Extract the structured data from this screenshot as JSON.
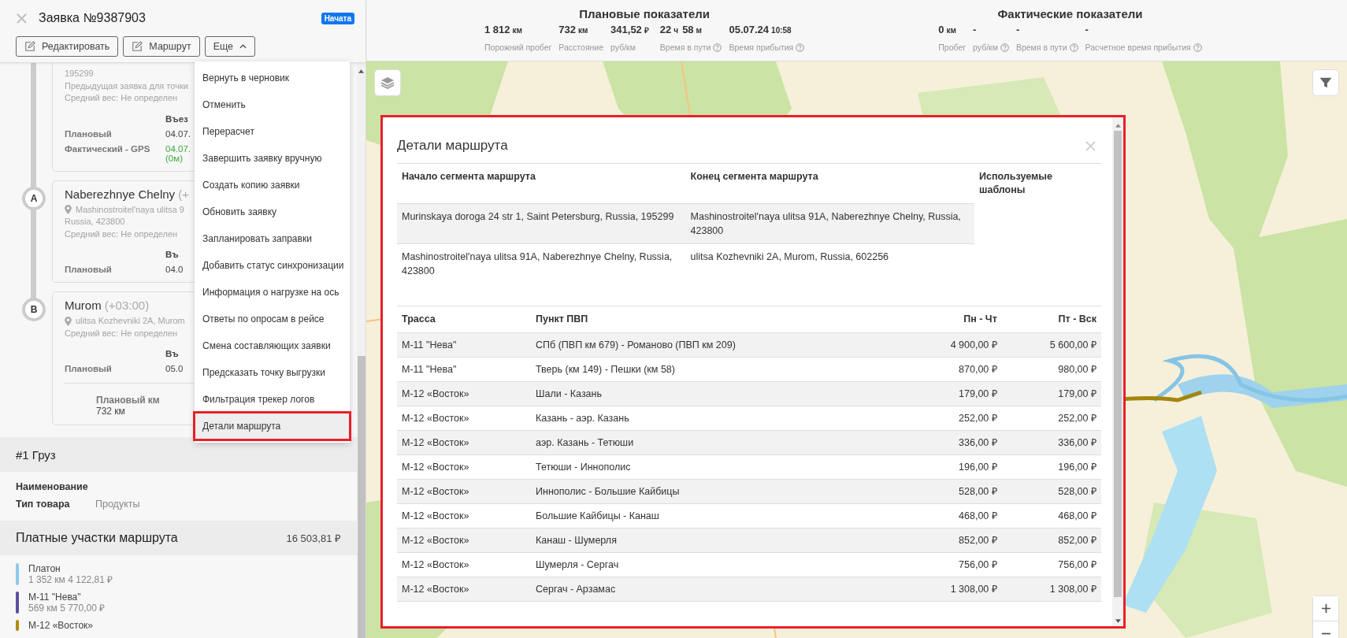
{
  "order": {
    "title": "Заявка №9387903",
    "status": "Начата",
    "buttons": [
      {
        "label": "Редактировать",
        "kind": "edit"
      },
      {
        "label": "Маршрут",
        "kind": "edit"
      },
      {
        "label": "Еще",
        "kind": "caret"
      }
    ]
  },
  "stops": [
    {
      "address": [
        "195299",
        "Предыдущая заявка для точки"
      ],
      "weight": "Средний вес: Не определен",
      "entry_header": "Въез",
      "rows": [
        {
          "label": "Плановый",
          "kind": "plan",
          "value": "04.07."
        },
        {
          "label": "Фактический - GPS",
          "kind": "actual",
          "value": "04.07.",
          "note": "(0м)"
        }
      ]
    },
    {
      "marker": "A",
      "title": "Naberezhnye Chelny",
      "tz": "(+",
      "pin": true,
      "address": [
        "Mashinostroitel'naya ulitsa 9",
        "Russia, 423800"
      ],
      "weight": "Средний вес: Не определен",
      "entry_header": "Въ",
      "rows": [
        {
          "label": "Плановый",
          "kind": "plan",
          "value": "04.0"
        }
      ]
    },
    {
      "marker": "B",
      "title": "Murom",
      "tz": "(+03:00)",
      "pin": true,
      "address": [
        "ulitsa Kozhevniki 2A, Murom"
      ],
      "weight": "Средний вес: Не определен",
      "entry_header": "Въ",
      "rows": [
        {
          "label": "Плановый",
          "kind": "plan",
          "value": "05.0"
        }
      ],
      "km": {
        "label": "Плановый км",
        "value": "732 км"
      }
    }
  ],
  "menu": {
    "items": [
      {
        "label": "Вернуть в черновик",
        "selected": false
      },
      {
        "label": "Отменить",
        "selected": false
      },
      {
        "label": "Перерасчет",
        "selected": false
      },
      {
        "label": "Завершить заявку вручную",
        "selected": false
      },
      {
        "label": "Создать копию заявки",
        "selected": false
      },
      {
        "label": "Обновить заявку",
        "selected": false
      },
      {
        "label": "Запланировать заправки",
        "selected": false
      },
      {
        "label": "Добавить статус синхронизации",
        "selected": false
      },
      {
        "label": "Информация о нагрузке на ось",
        "selected": false
      },
      {
        "label": "Ответы по опросам в рейсе",
        "selected": false
      },
      {
        "label": "Смена составляющих заявки",
        "selected": false
      },
      {
        "label": "Предсказать точку выгрузки",
        "selected": false
      },
      {
        "label": "Фильтрация трекер логов",
        "selected": false
      },
      {
        "label": "Детали маршрута",
        "selected": true
      }
    ]
  },
  "cargo": {
    "title": "#1 Груз",
    "fields": [
      {
        "label": "Наименование"
      },
      {
        "label": "Тип товара",
        "value": "Продукты"
      }
    ]
  },
  "tolls": {
    "title": "Платные участки маршрута",
    "total": "16 503,81 ₽",
    "items": [
      {
        "name": "Платон",
        "detail": "1 352 км 4 122,81 ₽",
        "color": "#8ecbea"
      },
      {
        "name": "М-11 \"Нева\"",
        "detail": "569 км 5 770,00 ₽",
        "color": "#5d4f9e"
      },
      {
        "name": "М-12 «Восток»",
        "color": "#b38b0c"
      }
    ]
  },
  "stats": [
    {
      "title": "Плановые показатели",
      "items": [
        {
          "parts": [
            "1 812",
            "км"
          ],
          "label": "Порожний пробег"
        },
        {
          "parts": [
            "732",
            "км"
          ],
          "label": "Расстояние"
        },
        {
          "parts": [
            "341,52",
            "₽"
          ],
          "label": "руб/км"
        },
        {
          "parts": [
            "22",
            "ч",
            "58",
            "м"
          ],
          "label": "Время в пути",
          "help": true
        },
        {
          "parts": [
            "05.07.24",
            "10:58"
          ],
          "label": "Время прибытия",
          "help": true
        }
      ]
    },
    {
      "title": "Фактические показатели",
      "items": [
        {
          "parts": [
            "0",
            "км"
          ],
          "label": "Пробег"
        },
        {
          "parts": [
            "-"
          ],
          "label": "руб/км",
          "help": true
        },
        {
          "parts": [
            "-"
          ],
          "label": "Время в пути",
          "help": true
        },
        {
          "parts": [
            "-"
          ],
          "label": "Расчетное время прибытия",
          "help": true
        }
      ]
    }
  ],
  "modal": {
    "title": "Детали маршрута",
    "segments": {
      "columns": [
        "Начало сегмента маршрута",
        "Конец сегмента маршрута",
        "Используемые шаблоны"
      ],
      "rows": [
        [
          "Murinskaya doroga 24 str 1, Saint Petersburg, Russia, 195299",
          "Mashinostroitel'naya ulitsa 91A, Naberezhnye Chelny, Russia, 423800"
        ],
        [
          "Mashinostroitel'naya ulitsa 91A, Naberezhnye Chelny, Russia, 423800",
          "ulitsa Kozhevniki 2A, Murom, Russia, 602256"
        ]
      ]
    },
    "tolls": {
      "columns": [
        "Трасса",
        "Пункт ПВП",
        "Пн - Чт",
        "Пт - Вск"
      ],
      "rows": [
        [
          "М-11 \"Нева\"",
          "СПб (ПВП км 679) - Романово (ПВП км 209)",
          "4 900,00 ₽",
          "5 600,00 ₽"
        ],
        [
          "М-11 \"Нева\"",
          "Тверь (км 149) - Пешки (км 58)",
          "870,00 ₽",
          "980,00 ₽"
        ],
        [
          "М-12 «Восток»",
          "Шали - Казань",
          "179,00 ₽",
          "179,00 ₽"
        ],
        [
          "М-12 «Восток»",
          "Казань - аэр. Казань",
          "252,00 ₽",
          "252,00 ₽"
        ],
        [
          "М-12 «Восток»",
          "аэр. Казань - Тетюши",
          "336,00 ₽",
          "336,00 ₽"
        ],
        [
          "М-12 «Восток»",
          "Тетюши - Иннополис",
          "196,00 ₽",
          "196,00 ₽"
        ],
        [
          "М-12 «Восток»",
          "Иннополис - Большие Кайбицы",
          "528,00 ₽",
          "528,00 ₽"
        ],
        [
          "М-12 «Восток»",
          "Большие Кайбицы - Канаш",
          "468,00 ₽",
          "468,00 ₽"
        ],
        [
          "М-12 «Восток»",
          "Канаш - Шумерля",
          "852,00 ₽",
          "852,00 ₽"
        ],
        [
          "М-12 «Восток»",
          "Шумерля - Сергач",
          "756,00 ₽",
          "756,00 ₽"
        ],
        [
          "М-12 «Восток»",
          "Сергач - Арзамас",
          "1 308,00 ₽",
          "1 308,00 ₽"
        ]
      ]
    }
  }
}
